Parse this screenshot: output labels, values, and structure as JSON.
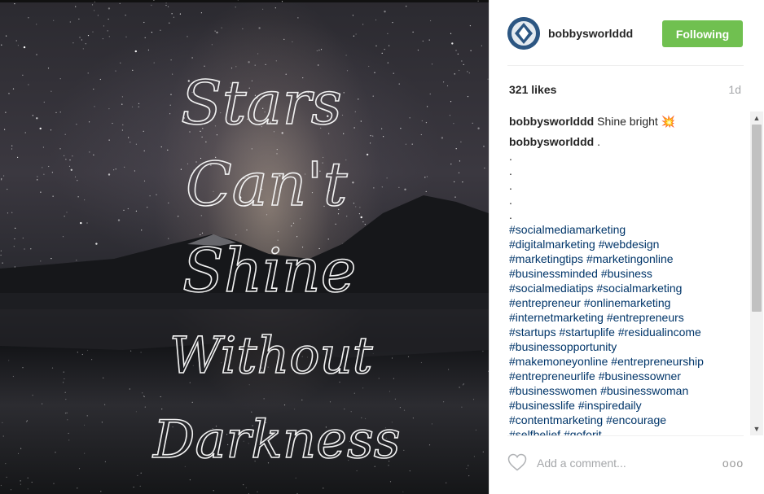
{
  "post": {
    "image_alt": "Starry night over a mountain lake with the text",
    "overlay_lines": [
      "Stars",
      "Can't",
      "Shine",
      "Without",
      "Darkness"
    ]
  },
  "header": {
    "username": "bobbysworlddd",
    "follow_label": "Following"
  },
  "stats": {
    "likes": "321 likes",
    "age": "1d"
  },
  "caption": {
    "user": "bobbysworlddd",
    "text": "Shine bright 💥"
  },
  "second_comment": {
    "user": "bobbysworlddd",
    "text": ".",
    "dots": [
      ".",
      ".",
      ".",
      ".",
      "."
    ]
  },
  "hashtag_lines": [
    "#socialmediamarketing",
    "#digitalmarketing #webdesign",
    "#marketingtips #marketingonline",
    "#businessminded #business",
    "#socialmediatips #socialmarketing",
    "#entrepreneur #onlinemarketing",
    "#internetmarketing #entrepreneurs",
    "#startups #startuplife #residualincome",
    "#businessopportunity",
    "#makemoneyonline #entrepreneurship",
    "#entrepreneurlife #businessowner",
    "#businesswomen #businesswoman",
    "#businesslife #inspiredaily",
    "#contentmarketing #encourage",
    "#selfbelief #goforit"
  ],
  "footer": {
    "comment_placeholder": "Add a comment...",
    "more_label": "ooo"
  },
  "colors": {
    "follow_green": "#70c050",
    "hashtag_blue": "#003569",
    "text_dark": "#262626",
    "muted_gray": "#a5a7aa"
  },
  "icons": {
    "like": "heart-outline-icon",
    "more": "more-options-icon",
    "scroll_up": "arrow-up-icon",
    "scroll_down": "arrow-down-icon"
  }
}
